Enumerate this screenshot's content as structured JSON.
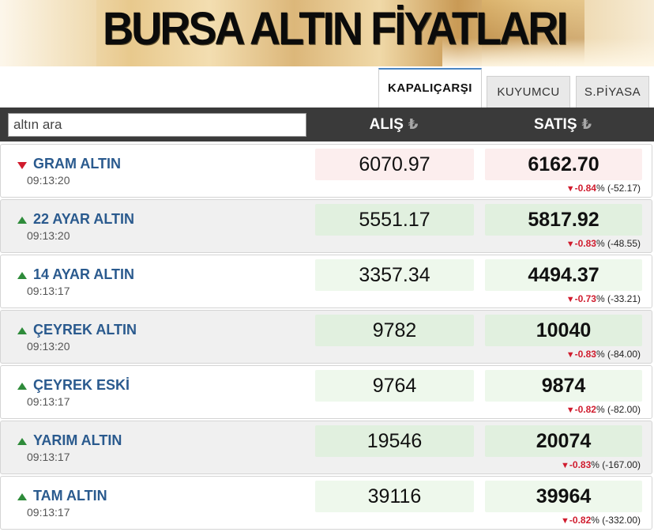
{
  "banner": {
    "title": "BURSA ALTIN FİYATLARI"
  },
  "tabs": [
    {
      "label": "KAPALIÇARŞI",
      "active": true
    },
    {
      "label": "KUYUMCU",
      "active": false
    },
    {
      "label": "S.PİYASA",
      "active": false
    }
  ],
  "search": {
    "placeholder": "altın ara"
  },
  "columns": {
    "buy": "ALIŞ",
    "sell": "SATIŞ",
    "currency_symbol": "₺"
  },
  "colors": {
    "accent_blue": "#2a5a8e",
    "down_red": "#d01c2e",
    "up_green": "#2e8b3a",
    "header_dark": "#3a3a3a"
  },
  "rows": [
    {
      "name": "GRAM ALTIN",
      "time": "09:13:20",
      "direction": "down",
      "buy": "6070.97",
      "sell": "6162.70",
      "change_pct": "-0.84",
      "pct_sign": "%",
      "change_abs": "(-52.17)"
    },
    {
      "name": "22 AYAR ALTIN",
      "time": "09:13:20",
      "direction": "up",
      "buy": "5551.17",
      "sell": "5817.92",
      "change_pct": "-0.83",
      "pct_sign": "%",
      "change_abs": "(-48.55)"
    },
    {
      "name": "14 AYAR ALTIN",
      "time": "09:13:17",
      "direction": "up",
      "buy": "3357.34",
      "sell": "4494.37",
      "change_pct": "-0.73",
      "pct_sign": "%",
      "change_abs": "(-33.21)"
    },
    {
      "name": "ÇEYREK ALTIN",
      "time": "09:13:20",
      "direction": "up",
      "buy": "9782",
      "sell": "10040",
      "change_pct": "-0.83",
      "pct_sign": "%",
      "change_abs": "(-84.00)"
    },
    {
      "name": "ÇEYREK ESKİ",
      "time": "09:13:17",
      "direction": "up",
      "buy": "9764",
      "sell": "9874",
      "change_pct": "-0.82",
      "pct_sign": "%",
      "change_abs": "(-82.00)"
    },
    {
      "name": "YARIM ALTIN",
      "time": "09:13:17",
      "direction": "up",
      "buy": "19546",
      "sell": "20074",
      "change_pct": "-0.83",
      "pct_sign": "%",
      "change_abs": "(-167.00)"
    },
    {
      "name": "TAM ALTIN",
      "time": "09:13:17",
      "direction": "up",
      "buy": "39116",
      "sell": "39964",
      "change_pct": "-0.82",
      "pct_sign": "%",
      "change_abs": "(-332.00)"
    }
  ]
}
